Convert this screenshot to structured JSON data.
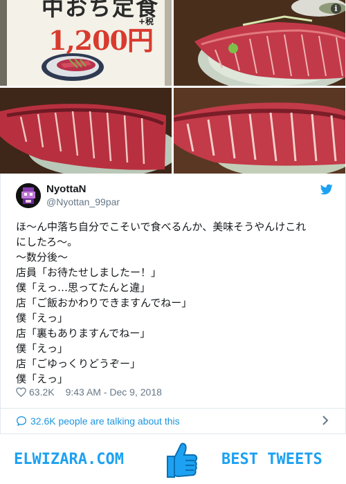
{
  "photos": {
    "menu_title": "中おち定食",
    "menu_price": "1,200円",
    "menu_tax": "+税"
  },
  "tweet": {
    "name": "NyottaN",
    "handle": "@Nyottan_99par",
    "lines": [
      "ほ〜ん中落ち自分でこそいで食べるんか、美味そうやんけこれ",
      "にしたろ〜。",
      "〜数分後〜",
      "店員「お待たせしましたー！」",
      "僕「えっ…思ってたんと違」",
      "店「ご飯おかわりできますんでねー」",
      "僕「えっ」",
      "店「裏もありますんでねー」",
      "僕「えっ」",
      "店「ごゆっくりどうぞー」",
      "僕「えっ」"
    ],
    "likes": "63.2K",
    "timestamp": "9:43 AM - Dec 9, 2018",
    "talking": "32.6K people are talking about this"
  },
  "footer": {
    "left": "ELWIZARA.COM",
    "right": "BEST TWEETS"
  },
  "colors": {
    "twitter_blue": "#1da1f2",
    "link_blue": "#1b95e0",
    "muted": "#657786",
    "tuna": "#c8384a"
  },
  "icons": [
    "info-icon",
    "twitter-bird-icon",
    "heart-icon",
    "speech-bubble-icon",
    "chevron-right-icon",
    "thumbs-up-icon"
  ]
}
